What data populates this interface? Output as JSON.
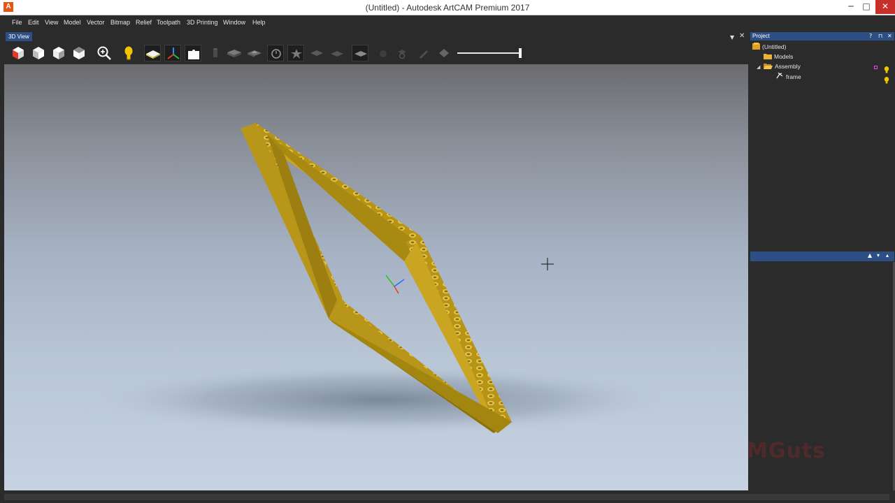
{
  "window": {
    "title": "(Untitled) - Autodesk ArtCAM Premium 2017",
    "app_logo": "A",
    "minimize": "─",
    "maximize": "□",
    "close": "✕"
  },
  "menu": {
    "items": [
      "File",
      "Edit",
      "View",
      "Model",
      "Vector",
      "Bitmap",
      "Relief",
      "Toolpath",
      "3D Printing",
      "Window",
      "Help"
    ]
  },
  "view_tab": {
    "label": "3D View",
    "dropdown": "▼",
    "close": "✕"
  },
  "toolbar": {
    "icons": [
      "view-iso-icon",
      "view-front-icon",
      "view-side-icon",
      "view-top-icon",
      "zoom-icon",
      "light-bulb-icon",
      "material-plane-icon",
      "axes-icon",
      "puzzle-icon",
      "cylinder-icon",
      "solid-icon",
      "relief-icon",
      "clock-view-icon",
      "star-icon",
      "layer-icon",
      "layer2-icon",
      "layer-dark-icon",
      "sphere-icon",
      "magnify-icon",
      "pen-icon",
      "diamond-icon"
    ],
    "slider_level": 1.0
  },
  "colors": {
    "accent": "#2e4f86",
    "frame_gold": "#c9a521",
    "background": "#2b2b2b"
  },
  "project_panel": {
    "title": "Project",
    "controls": [
      "?",
      "⊓",
      "✕"
    ],
    "tree": [
      {
        "label": "(Untitled)",
        "icon": "project-icon"
      },
      {
        "label": "Models",
        "icon": "folder-icon"
      },
      {
        "label": "Assembly",
        "icon": "folder-open-icon"
      },
      {
        "label": "frame",
        "icon": "model-icon"
      }
    ],
    "expand_marker": "◢"
  },
  "lower_panel": {
    "controls": [
      "▲",
      "▾",
      "▴"
    ]
  },
  "watermark": "MGuts"
}
